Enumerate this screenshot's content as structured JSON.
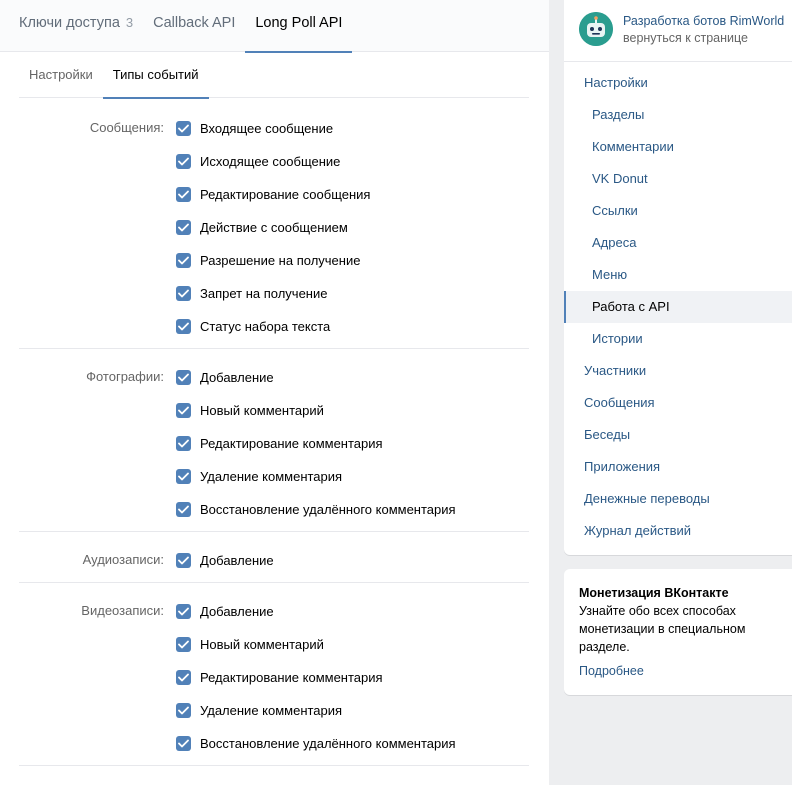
{
  "top_tabs": [
    {
      "label": "Ключи доступа",
      "count": "3"
    },
    {
      "label": "Callback API"
    },
    {
      "label": "Long Poll API"
    }
  ],
  "sub_tabs": [
    {
      "label": "Настройки"
    },
    {
      "label": "Типы событий"
    }
  ],
  "groups": [
    {
      "label": "Сообщения:",
      "items": [
        "Входящее сообщение",
        "Исходящее сообщение",
        "Редактирование сообщения",
        "Действие с сообщением",
        "Разрешение на получение",
        "Запрет на получение",
        "Статус набора текста"
      ]
    },
    {
      "label": "Фотографии:",
      "items": [
        "Добавление",
        "Новый комментарий",
        "Редактирование комментария",
        "Удаление комментария",
        "Восстановление удалённого комментария"
      ]
    },
    {
      "label": "Аудиозаписи:",
      "items": [
        "Добавление"
      ]
    },
    {
      "label": "Видеозаписи:",
      "items": [
        "Добавление",
        "Новый комментарий",
        "Редактирование комментария",
        "Удаление комментария",
        "Восстановление удалённого комментария"
      ]
    }
  ],
  "sidebar": {
    "title": "Разработка ботов RimWorld",
    "subtitle": "вернуться к странице",
    "items": [
      {
        "label": "Настройки",
        "sub": false
      },
      {
        "label": "Разделы",
        "sub": true
      },
      {
        "label": "Комментарии",
        "sub": true
      },
      {
        "label": "VK Donut",
        "sub": true
      },
      {
        "label": "Ссылки",
        "sub": true
      },
      {
        "label": "Адреса",
        "sub": true
      },
      {
        "label": "Меню",
        "sub": true
      },
      {
        "label": "Работа с API",
        "sub": true,
        "selected": true
      },
      {
        "label": "Истории",
        "sub": true
      },
      {
        "label": "Участники",
        "sub": false
      },
      {
        "label": "Сообщения",
        "sub": false
      },
      {
        "label": "Беседы",
        "sub": false
      },
      {
        "label": "Приложения",
        "sub": false
      },
      {
        "label": "Денежные переводы",
        "sub": false
      },
      {
        "label": "Журнал действий",
        "sub": false
      }
    ]
  },
  "promo": {
    "title": "Монетизация ВКонтакте",
    "text": "Узнайте обо всех способах монетизации в специальном разделе.",
    "link": "Подробнее"
  },
  "colors": {
    "accent": "#5181b8",
    "link": "#2a5885"
  }
}
